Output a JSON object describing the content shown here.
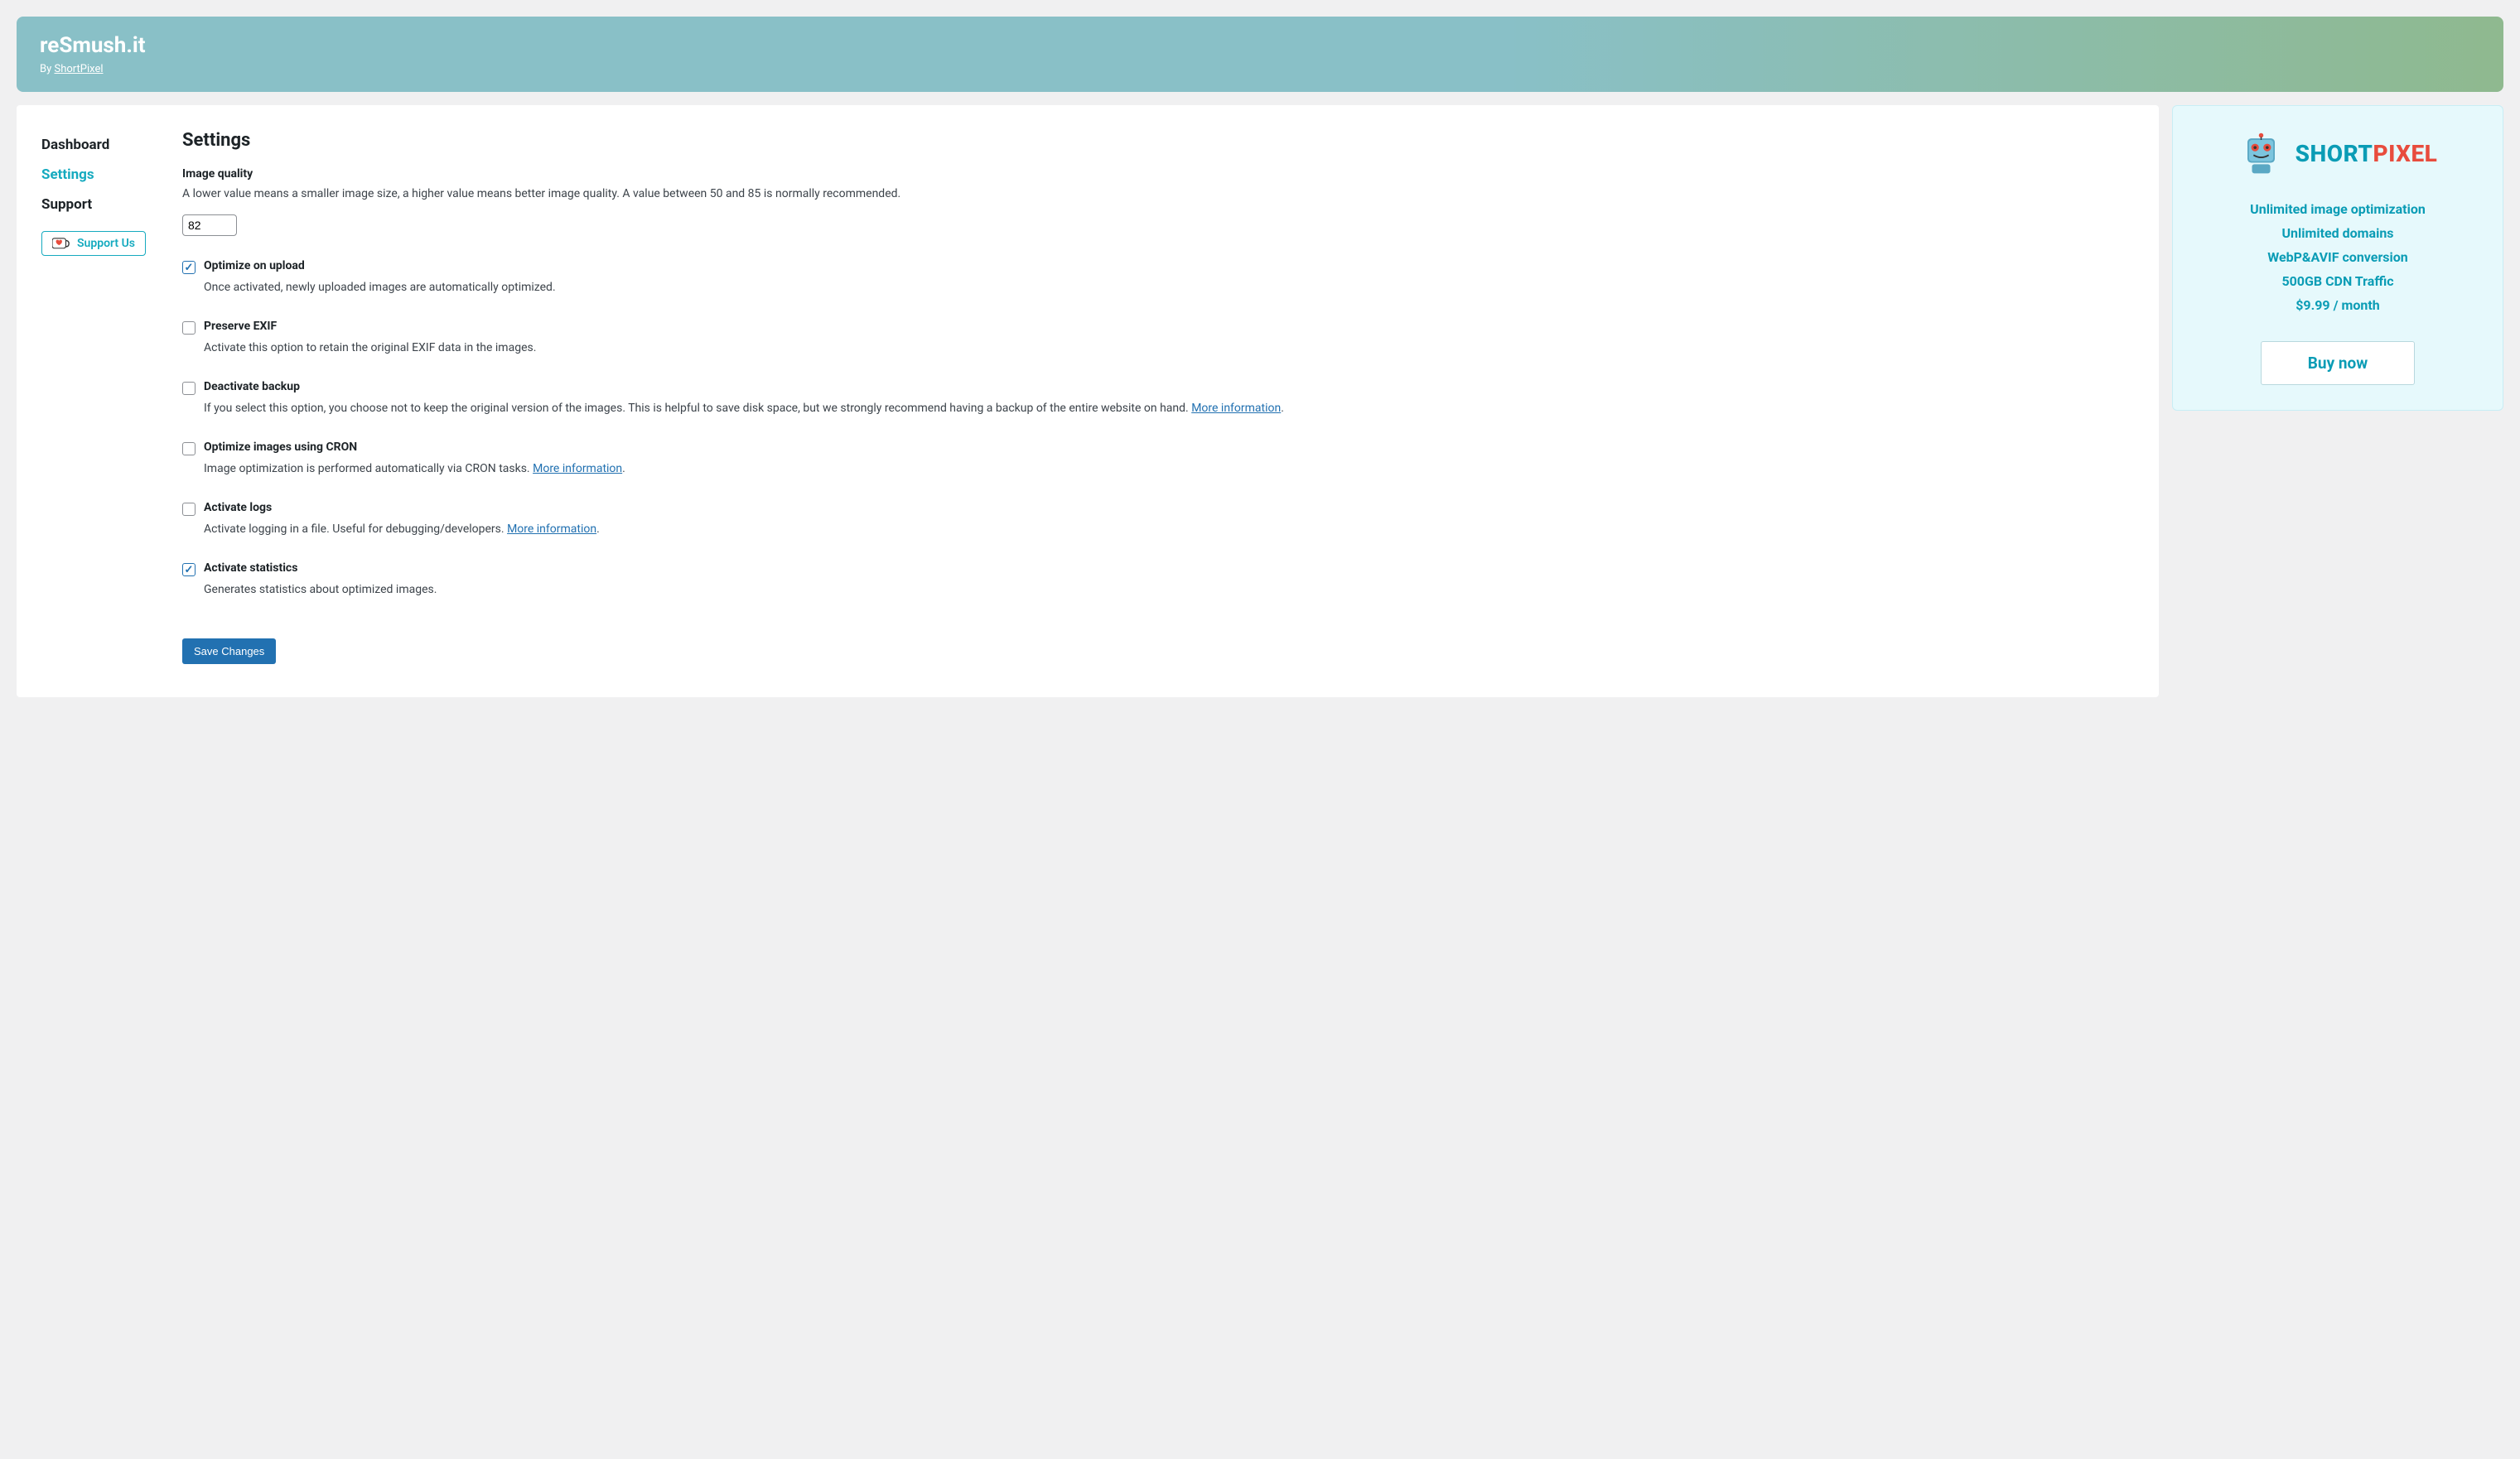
{
  "header": {
    "title": "reSmush.it",
    "byline_prefix": "By ",
    "byline_link": "ShortPixel"
  },
  "nav": {
    "dashboard": "Dashboard",
    "settings": "Settings",
    "support": "Support",
    "support_us": "Support Us"
  },
  "page": {
    "title": "Settings",
    "image_quality_label": "Image quality",
    "image_quality_desc": "A lower value means a smaller image size, a higher value means better image quality. A value between 50 and 85 is normally recommended.",
    "image_quality_value": "82",
    "options": [
      {
        "checked": true,
        "label": "Optimize on upload",
        "desc": "Once activated, newly uploaded images are automatically optimized.",
        "link": null
      },
      {
        "checked": false,
        "label": "Preserve EXIF",
        "desc": "Activate this option to retain the original EXIF data in the images.",
        "link": null
      },
      {
        "checked": false,
        "label": "Deactivate backup",
        "desc": "If you select this option, you choose not to keep the original version of the images. This is helpful to save disk space, but we strongly recommend having a backup of the entire website on hand. ",
        "link": "More information"
      },
      {
        "checked": false,
        "label": "Optimize images using CRON",
        "desc": "Image optimization is performed automatically via CRON tasks. ",
        "link": "More information"
      },
      {
        "checked": false,
        "label": "Activate logs",
        "desc": "Activate logging in a file. Useful for debugging/developers. ",
        "link": "More information"
      },
      {
        "checked": true,
        "label": "Activate statistics",
        "desc": "Generates statistics about optimized images.",
        "link": null
      }
    ],
    "save_label": "Save Changes"
  },
  "promo": {
    "logo_short": "SHORT",
    "logo_pixel": "PIXEL",
    "features": [
      "Unlimited image optimization",
      "Unlimited domains",
      "WebP&AVIF conversion",
      "500GB CDN Traffic",
      "$9.99 / month"
    ],
    "buy_now": "Buy now"
  }
}
